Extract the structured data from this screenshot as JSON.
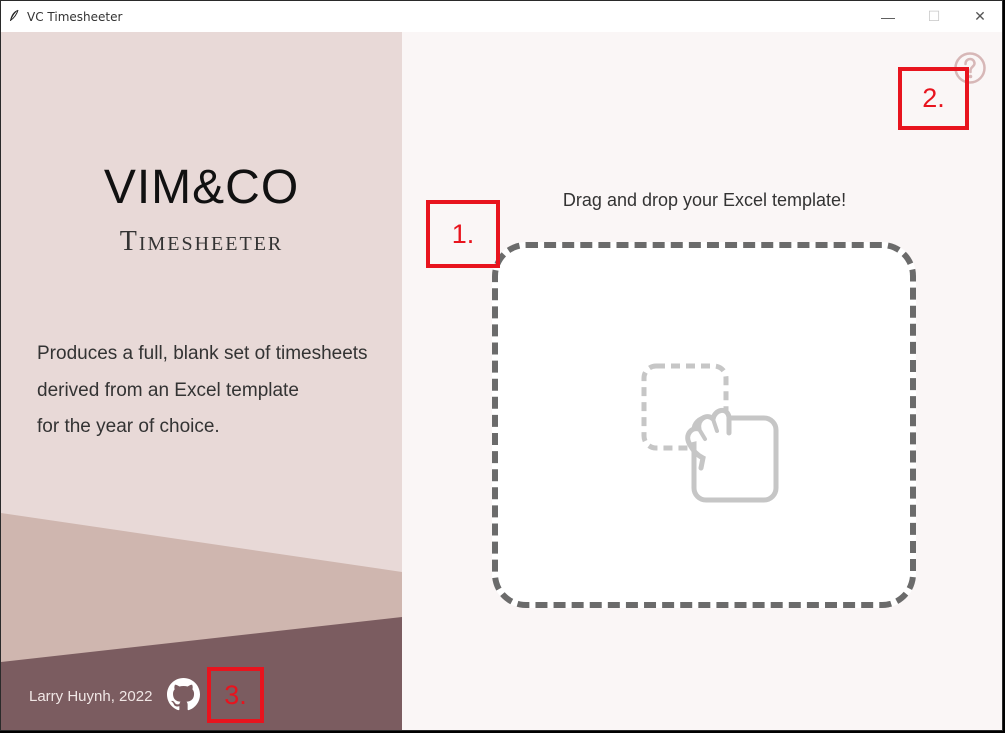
{
  "window": {
    "title": "VC Timesheeter",
    "controls": {
      "minimize": "—",
      "maximize": "☐",
      "close": "✕"
    }
  },
  "sidebar": {
    "logo_main": "VIM&CO",
    "logo_sub": "Timesheeter",
    "description": [
      "Produces a full, blank set of timesheets",
      "derived from an Excel template",
      "for the year of choice."
    ],
    "credit": "Larry Huynh, 2022",
    "github_icon": "github-icon"
  },
  "main": {
    "help_icon": "question-circle-icon",
    "drop_title": "Drag and drop your Excel template!",
    "drop_icon": "drag-drop-hand-icon"
  },
  "annotations": [
    {
      "label": "1."
    },
    {
      "label": "2."
    },
    {
      "label": "3."
    }
  ],
  "colors": {
    "sidebar_bg": "#e8d9d7",
    "sidebar_band": "#cfb6af",
    "sidebar_footer": "#7b5c60",
    "main_bg": "#faf6f6",
    "dash": "#6b6b6b",
    "annotation": "#e8141e"
  }
}
